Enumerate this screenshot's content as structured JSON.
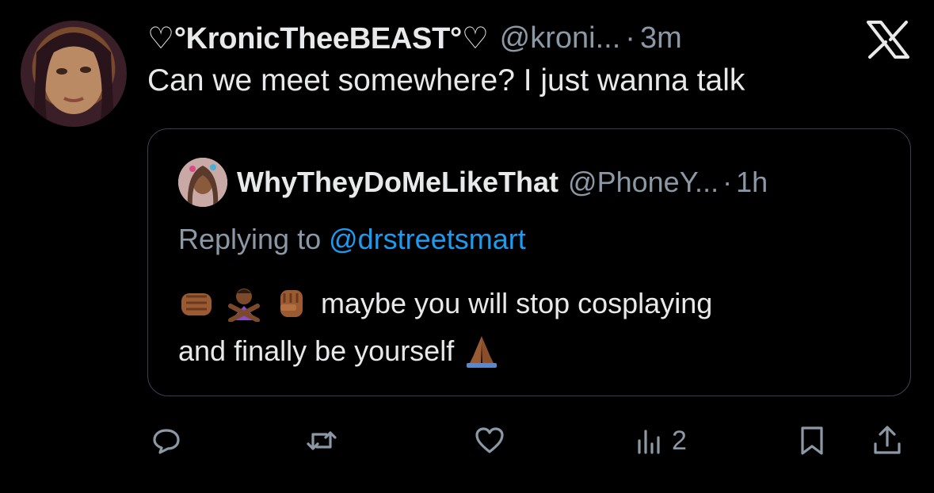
{
  "tweet": {
    "author_name": "♡°KronicTheeBEAST°♡",
    "author_handle": "@kroni...",
    "separator": "·",
    "time": "3m",
    "text": "Can we meet somewhere? I just wanna talk"
  },
  "quoted": {
    "author_name": "WhyTheyDoMeLikeThat",
    "author_handle": "@PhoneY...",
    "separator": "·",
    "time": "1h",
    "replying_prefix": "Replying to",
    "replying_handle": "@drstreetsmart",
    "text_line1": "maybe you will stop cosplaying",
    "text_line2": "and finally be yourself",
    "emojis": [
      "oncoming-fist-emoji",
      "gesturing-no-emoji",
      "raised-fist-emoji",
      "folded-hands-emoji"
    ]
  },
  "actions": {
    "reply_icon": "reply-icon",
    "retweet_icon": "retweet-icon",
    "like_icon": "like-icon",
    "views_icon": "views-icon",
    "views_count": "2",
    "bookmark_icon": "bookmark-icon",
    "share_icon": "share-icon"
  },
  "colors": {
    "background": "#000000",
    "text": "#e7e9ea",
    "secondary": "#8b98a5",
    "link": "#1d9bf0",
    "border": "#38444d"
  }
}
